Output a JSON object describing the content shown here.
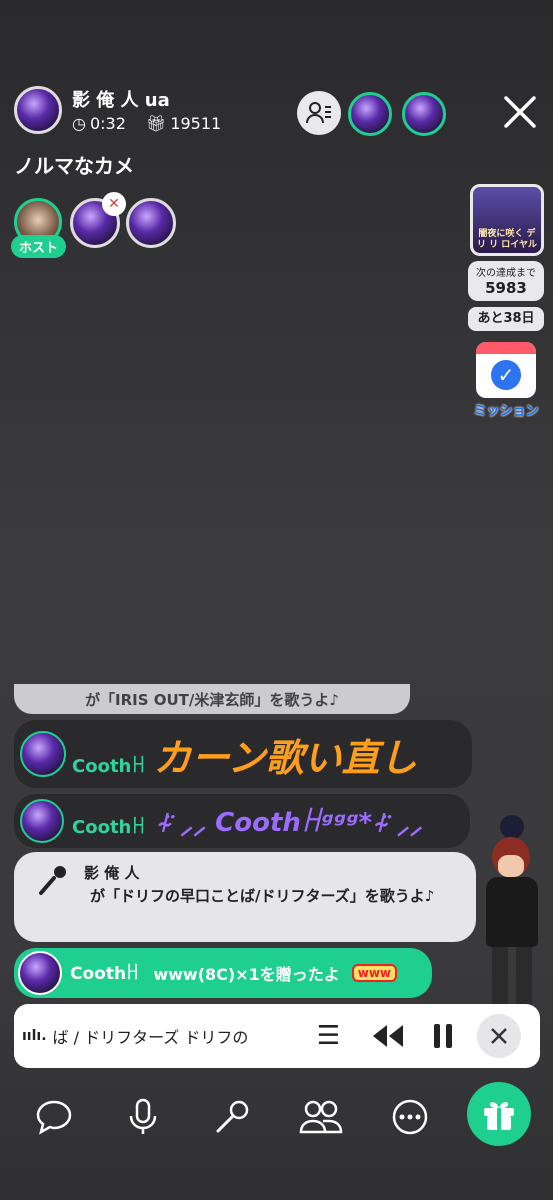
{
  "header": {
    "host_name": "影 俺 人 ua",
    "timer": "0:32",
    "gift_count": "19511",
    "room_title": "ノルマなカメ",
    "host_chip": "ホスト"
  },
  "event": {
    "banner_text": "闇夜に咲く デリ リ ロイヤル",
    "progress_label": "次の達成まで",
    "progress_value": "5983",
    "days_left": "あと38日",
    "mission_label": "ミッション"
  },
  "chat": {
    "partial_message": "が「IRIS OUT/米津玄師」を歌うよ♪",
    "msg1_user": "Coothꀿ",
    "msg1_text": "カーン歌い直し",
    "msg2_user": "Coothꀿ",
    "msg2_text": "⍭̈ ⸝⸝ Coothꀿᵍᵍᵍ*⍭̈ ⸝⸝",
    "msg3_user": "影 俺 人",
    "msg3_text": "が「ドリフの早口ことば/ドリフターズ」を歌うよ♪",
    "msg4_user": "Coothꀿ",
    "msg4_text": "www(8C)×1を贈ったよ",
    "msg4_badge": "www"
  },
  "player": {
    "now_playing": "ば / ドリフターズ  ドリフの"
  },
  "icons": {
    "toolbar": [
      "chat-icon",
      "mic-icon",
      "karaoke-icon",
      "users-icon",
      "more-icon",
      "gift-icon"
    ]
  },
  "colors": {
    "accent_green": "#1ecf8f",
    "highlight_orange": "#ff9e1b",
    "purple_text": "#9b6cff"
  }
}
